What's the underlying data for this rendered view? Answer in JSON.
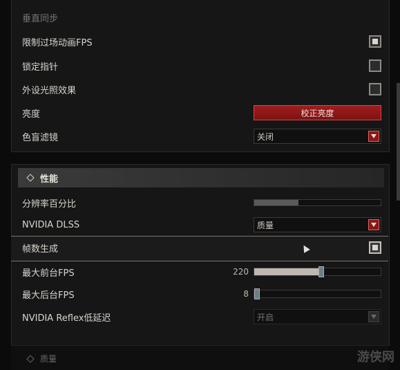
{
  "display": {
    "vsync_label": "垂直同步",
    "cutscene_fps_label": "限制过场动画FPS",
    "cutscene_fps_checked": true,
    "lock_cursor_label": "锁定指针",
    "lock_cursor_checked": false,
    "peripheral_light_label": "外设光照效果",
    "peripheral_light_checked": false,
    "brightness_label": "亮度",
    "brightness_button": "校正亮度",
    "colorblind_label": "色盲滤镜",
    "colorblind_value": "关闭"
  },
  "performance": {
    "section_title": "性能",
    "resolution_scale_label": "分辨率百分比",
    "resolution_scale_fraction": 0.35,
    "dlss_label": "NVIDIA DLSS",
    "dlss_value": "质量",
    "frame_gen_label": "帧数生成",
    "frame_gen_checked": true,
    "max_fg_fps_label": "最大前台FPS",
    "max_fg_fps_value": "220",
    "max_fg_fps_fraction": 0.53,
    "max_bg_fps_label": "最大后台FPS",
    "max_bg_fps_value": "8",
    "max_bg_fps_fraction": 0.02,
    "reflex_label": "NVIDIA Reflex低延迟",
    "reflex_value": "开启"
  },
  "quality": {
    "section_title": "质量"
  },
  "watermark": "游侠网",
  "colors": {
    "accent_red": "#8a1717",
    "panel": "#161616"
  }
}
